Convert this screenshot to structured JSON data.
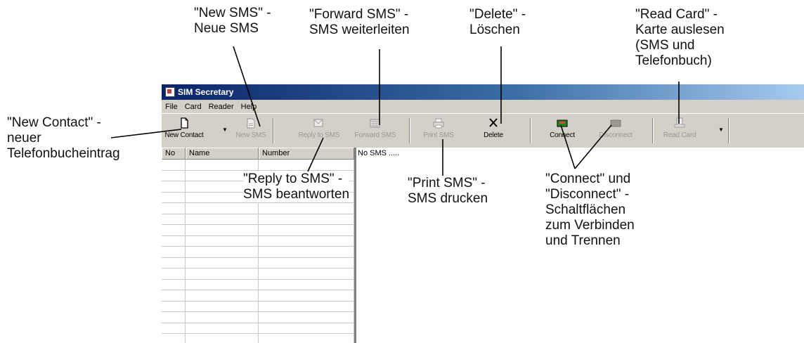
{
  "window": {
    "title": "SIM Secretary"
  },
  "menu": [
    "File",
    "Card",
    "Reader",
    "Help"
  ],
  "toolbar": {
    "new_contact": "New Contact",
    "new_sms": "New SMS",
    "reply_sms": "Reply to SMS",
    "forward_sms": "Forward SMS",
    "print_sms": "Print SMS",
    "delete": "Delete",
    "connect": "Connect",
    "disconnect": "Disconnect",
    "read_card": "Read Card"
  },
  "contacts_table": {
    "columns": [
      "No",
      "Name",
      "Number"
    ]
  },
  "sms_pane": {
    "empty_text": "No SMS ....."
  },
  "annotations": {
    "new_sms": [
      "\"New SMS\" -",
      "Neue SMS"
    ],
    "forward_sms": [
      "\"Forward SMS\" -",
      "SMS weiterleiten"
    ],
    "delete": [
      "\"Delete\" -",
      "Löschen"
    ],
    "read_card": [
      "\"Read Card\" -",
      "Karte auslesen",
      "(SMS und",
      "Telefonbuch)"
    ],
    "new_contact": [
      "\"New Contact\" -",
      "neuer",
      "Telefonbucheintrag"
    ],
    "reply_sms": [
      "\"Reply to SMS\" -",
      "SMS beantworten"
    ],
    "print_sms": [
      "\"Print SMS\" -",
      "SMS drucken"
    ],
    "connect": [
      "\"Connect\" und",
      "\"Disconnect\" -",
      "Schaltflächen",
      "zum Verbinden",
      "und Trennen"
    ]
  }
}
